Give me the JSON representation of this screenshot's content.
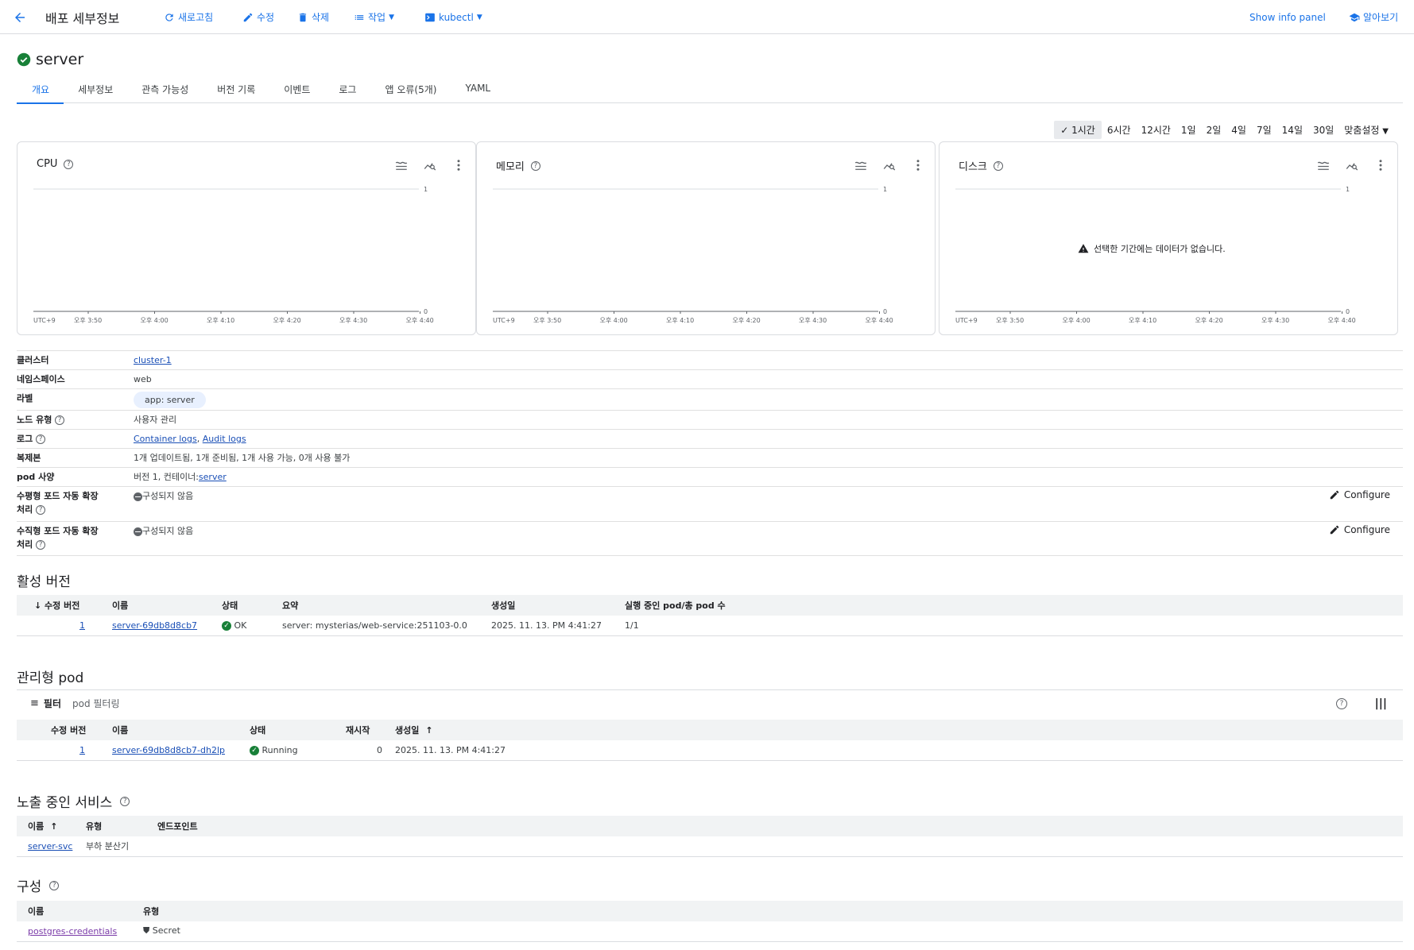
{
  "topbar": {
    "heading": "배포 세부정보",
    "refresh": "새로고침",
    "edit": "수정",
    "delete": "삭제",
    "actions": "작업",
    "kubectl": "kubectl",
    "info_panel": "Show info panel",
    "learn": "알아보기"
  },
  "deployment": {
    "name": "server"
  },
  "tabs": [
    "개요",
    "세부정보",
    "관측 가능성",
    "버전 기록",
    "이벤트",
    "로그",
    "앱 오류(5개)",
    "YAML"
  ],
  "time_range": {
    "options": [
      "1시간",
      "6시간",
      "12시간",
      "1일",
      "2일",
      "4일",
      "7일",
      "14일",
      "30일",
      "맞춤설정"
    ],
    "selected": "1시간"
  },
  "charts": {
    "no_data_message": "선택한 기간에는 데이터가 없습니다."
  },
  "chart_data": [
    {
      "type": "line",
      "title": "CPU",
      "timezone": "UTC+9",
      "x_tick_labels": [
        "오후 3:50",
        "오후 4:00",
        "오후 4:10",
        "오후 4:20",
        "오후 4:30",
        "오후 4:40"
      ],
      "ylim": [
        0,
        1
      ],
      "y_tick_labels": [
        "0",
        "1"
      ],
      "series": [],
      "grid": true
    },
    {
      "type": "line",
      "title": "메모리",
      "timezone": "UTC+9",
      "x_tick_labels": [
        "오후 3:50",
        "오후 4:00",
        "오후 4:10",
        "오후 4:20",
        "오후 4:30",
        "오후 4:40"
      ],
      "ylim": [
        0,
        1
      ],
      "y_tick_labels": [
        "0",
        "1"
      ],
      "series": [],
      "grid": true
    },
    {
      "type": "line",
      "title": "디스크",
      "timezone": "UTC+9",
      "x_tick_labels": [
        "오후 3:50",
        "오후 4:00",
        "오후 4:10",
        "오후 4:20",
        "오후 4:30",
        "오후 4:40"
      ],
      "ylim": [
        0,
        1
      ],
      "y_tick_labels": [
        "0",
        "1"
      ],
      "series": [],
      "grid": true,
      "annotation": "선택한 기간에는 데이터가 없습니다."
    }
  ],
  "details": {
    "cluster_label": "클러스터",
    "cluster_value": "cluster-1",
    "namespace_label": "네임스페이스",
    "namespace_value": "web",
    "labels_label": "라벨",
    "labels_value": "app: server",
    "node_type_label": "노드 유형",
    "node_type_value": "사용자 관리",
    "logs_label": "로그",
    "container_logs": "Container logs",
    "logs_separator": ", ",
    "audit_logs": "Audit logs",
    "replicas_label": "복제본",
    "replicas_value": "1개 업데이트됨, 1개 준비됨, 1개 사용 가능, 0개 사용 불가",
    "pod_spec_label": "pod 사양",
    "pod_spec_prefix": "버전 1, 컨테이너:",
    "pod_spec_container": "server",
    "hpa_label_1": "수평형 포드 자동 확장",
    "hpa_label_2": "처리",
    "hpa_value": "구성되지 않음",
    "vpa_label_1": "수직형 포드 자동 확장",
    "vpa_label_2": "처리",
    "vpa_value": "구성되지 않음",
    "configure": "Configure"
  },
  "active_revisions": {
    "title": "활성 버전",
    "headers": [
      "수정 버전",
      "이름",
      "상태",
      "요약",
      "생성일",
      "실행 중인 pod/총 pod 수"
    ],
    "rows": [
      {
        "revision": "1",
        "name": "server-69db8d8cb7",
        "status": "OK",
        "summary": "server: mysterias/web-service:251103-0.0",
        "created": "2025. 11. 13. PM 4:41:27",
        "pods": "1/1"
      }
    ]
  },
  "managed_pods": {
    "title": "관리형 pod",
    "filter_label": "필터",
    "filter_placeholder": "pod 필터링",
    "headers": [
      "수정 버전",
      "이름",
      "상태",
      "재시작",
      "생성일"
    ],
    "rows": [
      {
        "revision": "1",
        "name": "server-69db8d8cb7-dh2lp",
        "status": "Running",
        "restarts": "0",
        "created": "2025. 11. 13. PM 4:41:27"
      }
    ]
  },
  "exposed_services": {
    "title": "노출 중인 서비스",
    "headers": [
      "이름",
      "유형",
      "엔드포인트"
    ],
    "rows": [
      {
        "name": "server-svc",
        "type": "부하 분산기",
        "endpoint": ""
      }
    ]
  },
  "configuration": {
    "title": "구성",
    "headers": [
      "이름",
      "유형"
    ],
    "rows": [
      {
        "name": "postgres-credentials",
        "type": "Secret"
      }
    ]
  }
}
